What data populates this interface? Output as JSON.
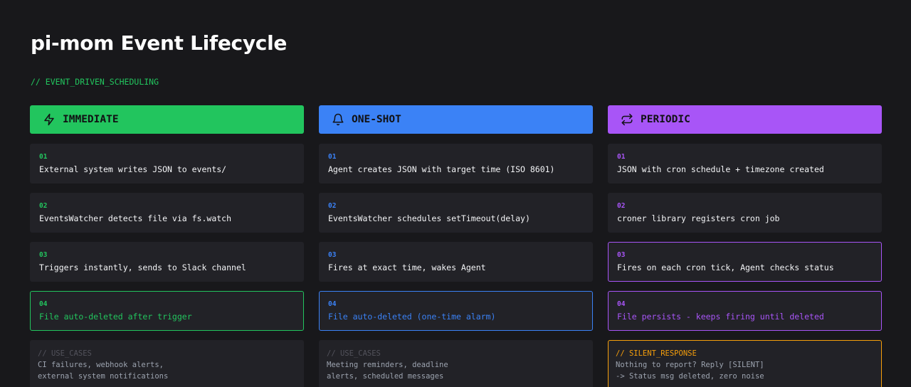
{
  "title": "pi-mom Event Lifecycle",
  "subtitle": "// EVENT_DRIVEN_SCHEDULING",
  "columns": [
    {
      "label": "IMMEDIATE",
      "icon": "lightning-icon",
      "color": "#22c55e",
      "steps": [
        {
          "num": "01",
          "text": "External system writes JSON to events/"
        },
        {
          "num": "02",
          "text": "EventsWatcher detects file via fs.watch"
        },
        {
          "num": "03",
          "text": "Triggers instantly, sends to Slack channel"
        },
        {
          "num": "04",
          "text": "File auto-deleted after trigger"
        }
      ],
      "note": {
        "title": "// USE_CASES",
        "lines": [
          "CI failures, webhook alerts,",
          "external system notifications"
        ]
      }
    },
    {
      "label": "ONE-SHOT",
      "icon": "bell-icon",
      "color": "#3b82f6",
      "steps": [
        {
          "num": "01",
          "text": "Agent creates JSON with target time (ISO 8601)"
        },
        {
          "num": "02",
          "text": "EventsWatcher schedules setTimeout(delay)"
        },
        {
          "num": "03",
          "text": "Fires at exact time, wakes Agent"
        },
        {
          "num": "04",
          "text": "File auto-deleted (one-time alarm)"
        }
      ],
      "note": {
        "title": "// USE_CASES",
        "lines": [
          "Meeting reminders, deadline",
          "alerts, scheduled messages"
        ]
      }
    },
    {
      "label": "PERIODIC",
      "icon": "repeat-icon",
      "color": "#a855f7",
      "steps": [
        {
          "num": "01",
          "text": "JSON with cron schedule + timezone created"
        },
        {
          "num": "02",
          "text": "croner library registers cron job"
        },
        {
          "num": "03",
          "text": "Fires on each cron tick, Agent checks status"
        },
        {
          "num": "04",
          "text": "File persists - keeps firing until deleted"
        }
      ],
      "note": {
        "title": "// SILENT_RESPONSE",
        "lines": [
          "Nothing to report? Reply [SILENT]",
          "-> Status msg deleted, zero noise"
        ]
      }
    }
  ]
}
